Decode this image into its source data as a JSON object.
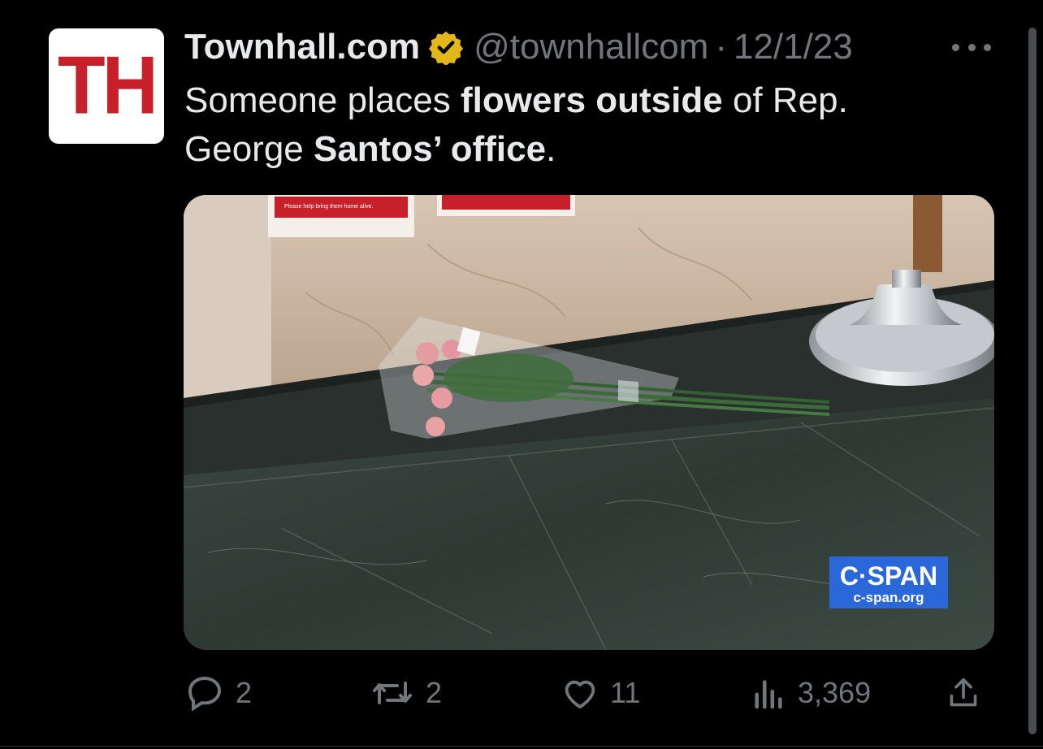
{
  "tweet": {
    "avatar_text": "TH",
    "display_name": "Townhall.com",
    "handle": "@townhallcom",
    "separator": "·",
    "date": "12/1/23",
    "text_parts": {
      "p1": "Someone places ",
      "b1": "flowers outside",
      "p2": " of Rep.",
      "p3": "George ",
      "b2": "Santos’ office",
      "p4": "."
    }
  },
  "media": {
    "sign_text": "Please help bring them home alive.",
    "logo_text": "C·SPAN",
    "logo_url": "c-span.org"
  },
  "actions": {
    "replies": "2",
    "reposts": "2",
    "likes": "11",
    "views": "3,369"
  },
  "colors": {
    "background": "#000000",
    "text": "#e7e9ea",
    "muted": "#71767b",
    "verified_gold": "#e2b719",
    "brand_red": "#c8202b",
    "cspan_blue": "#2a67d9"
  },
  "icons": {
    "verified": "verified-badge-icon",
    "more": "more-dots-icon",
    "reply": "reply-icon",
    "repost": "repost-icon",
    "like": "heart-icon",
    "views": "analytics-icon",
    "share": "share-icon"
  }
}
